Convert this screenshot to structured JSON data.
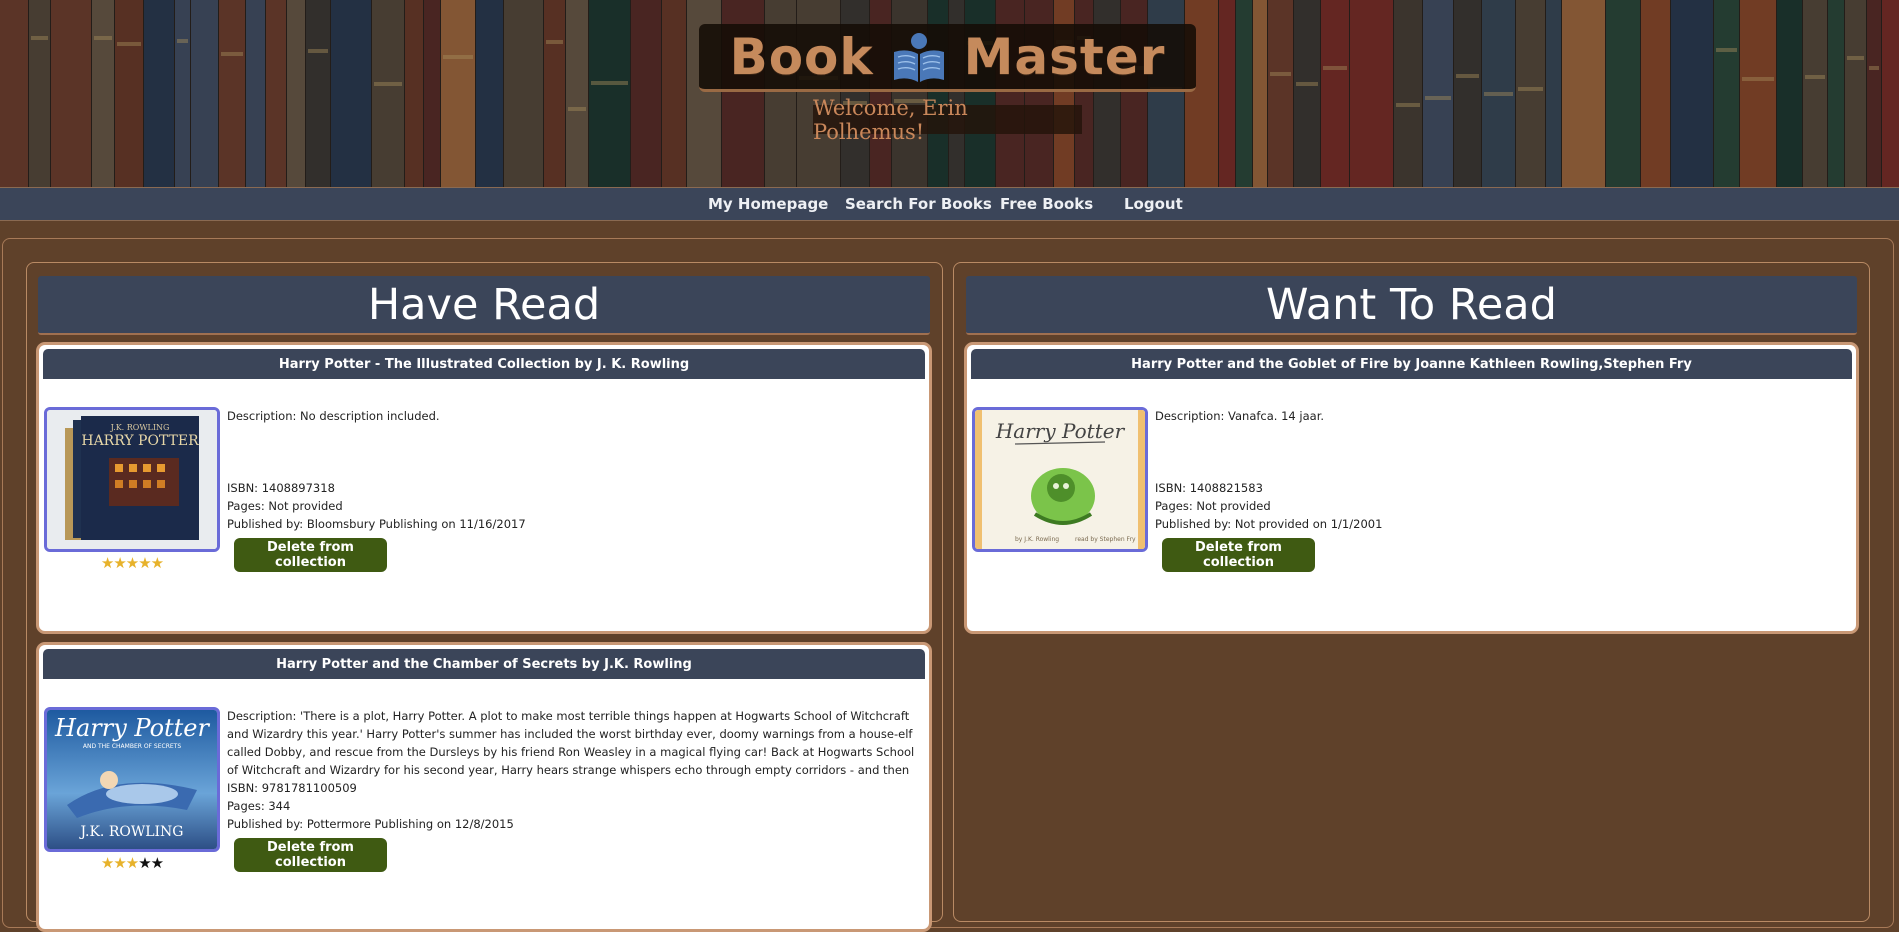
{
  "header": {
    "logo_left": "Book",
    "logo_right": "Master",
    "welcome": "Welcome, Erin Polhemus!"
  },
  "nav": {
    "items": [
      "My Homepage",
      "Search For Books",
      "Free Books",
      "Logout"
    ]
  },
  "have_read": {
    "title": "Have Read",
    "books": [
      {
        "heading": "Harry Potter - The Illustrated Collection by J. K. Rowling",
        "description": "Description: No description included.",
        "isbn": "ISBN: 1408897318",
        "pages": "Pages: Not provided",
        "published": "Published by: Bloomsbury Publishing on 11/16/2017",
        "rating": 5,
        "delete_label": "Delete from collection",
        "cover_title": "HARRY POTTER",
        "cover_author": "J.K. ROWLING"
      },
      {
        "heading": "Harry Potter and the Chamber of Secrets by J.K. Rowling",
        "description": "Description: 'There is a plot, Harry Potter. A plot to make most terrible things happen at Hogwarts School of Witchcraft and Wizardry this year.' Harry Potter's summer has included the worst birthday ever, doomy warnings from a house-elf called Dobby, and rescue from the Dursleys by his friend Ron Weasley in a magical flying car! Back at Hogwarts School of Witchcraft and Wizardry for his second year, Harry hears strange whispers echo through empty corridors - and then the attacks start. Students are found as",
        "isbn": "ISBN: 9781781100509",
        "pages": "Pages: 344",
        "published": "Published by: Pottermore Publishing on 12/8/2015",
        "rating": 3,
        "delete_label": "Delete from collection",
        "cover_title": "Harry Potter",
        "cover_author": "J.K. ROWLING"
      }
    ]
  },
  "want_to_read": {
    "title": "Want To Read",
    "books": [
      {
        "heading": "Harry Potter and the Goblet of Fire by Joanne Kathleen Rowling,Stephen Fry",
        "description": "Description: Vanafca. 14 jaar.",
        "isbn": "ISBN: 1408821583",
        "pages": "Pages: Not provided",
        "published": "Published by: Not provided on 1/1/2001",
        "delete_label": "Delete from collection",
        "cover_title": "Harry Potter"
      }
    ]
  },
  "colors": {
    "nav_bg": "#3b4559",
    "page_bg": "#5f412a",
    "button_bg": "#3f5a12",
    "cover_border": "#6a6bd8",
    "star": "#e7b22b"
  }
}
